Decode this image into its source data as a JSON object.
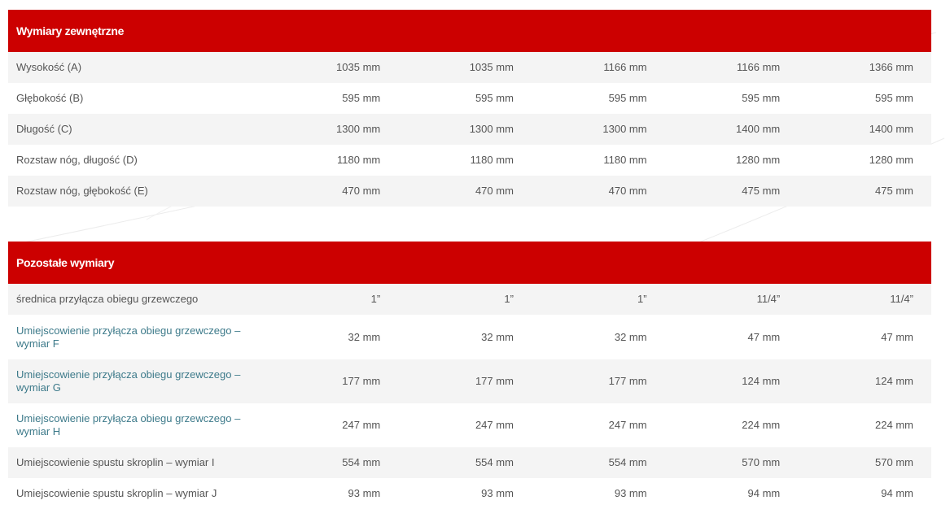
{
  "sections": [
    {
      "title": "Wymiary zewnętrzne",
      "rows": [
        {
          "label": "Wysokość (A)",
          "values": [
            "1035 mm",
            "1035 mm",
            "1166 mm",
            "1166 mm",
            "1366 mm"
          ]
        },
        {
          "label": "Głębokość (B)",
          "values": [
            "595 mm",
            "595 mm",
            "595 mm",
            "595 mm",
            "595 mm"
          ]
        },
        {
          "label": "Długość (C)",
          "values": [
            "1300 mm",
            "1300 mm",
            "1300 mm",
            "1400 mm",
            "1400 mm"
          ]
        },
        {
          "label": "Rozstaw nóg, długość (D)",
          "values": [
            "1180 mm",
            "1180 mm",
            "1180 mm",
            "1280 mm",
            "1280 mm"
          ]
        },
        {
          "label": "Rozstaw nóg, głębokość (E)",
          "values": [
            "470 mm",
            "470 mm",
            "470 mm",
            "475 mm",
            "475 mm"
          ]
        }
      ]
    },
    {
      "title": "Pozostałe wymiary",
      "rows": [
        {
          "label": "średnica przyłącza obiegu grzewczego",
          "values": [
            "1”",
            "1”",
            "1”",
            "11/4”",
            "11/4”"
          ]
        },
        {
          "label": "Umiejscowienie przyłącza obiegu grzewczego – wymiar F",
          "values": [
            "32 mm",
            "32 mm",
            "32 mm",
            "47 mm",
            "47 mm"
          ]
        },
        {
          "label": "Umiejscowienie przyłącza obiegu grzewczego – wymiar G",
          "values": [
            "177 mm",
            "177 mm",
            "177 mm",
            "124 mm",
            "124 mm"
          ]
        },
        {
          "label": "Umiejscowienie przyłącza obiegu grzewczego – wymiar H",
          "values": [
            "247 mm",
            "247 mm",
            "247 mm",
            "224 mm",
            "224 mm"
          ]
        },
        {
          "label": "Umiejscowienie spustu skroplin – wymiar I",
          "values": [
            "554 mm",
            "554 mm",
            "554 mm",
            "570 mm",
            "570 mm"
          ]
        },
        {
          "label": "Umiejscowienie spustu skroplin – wymiar J",
          "values": [
            "93 mm",
            "93 mm",
            "93 mm",
            "94 mm",
            "94 mm"
          ]
        }
      ]
    }
  ],
  "colors": {
    "header_bg": "#cc0000",
    "header_text": "#ffffff",
    "row_alt_bg": "#f4f4f4",
    "text": "#555555",
    "link_text": "#3d7a8a"
  }
}
